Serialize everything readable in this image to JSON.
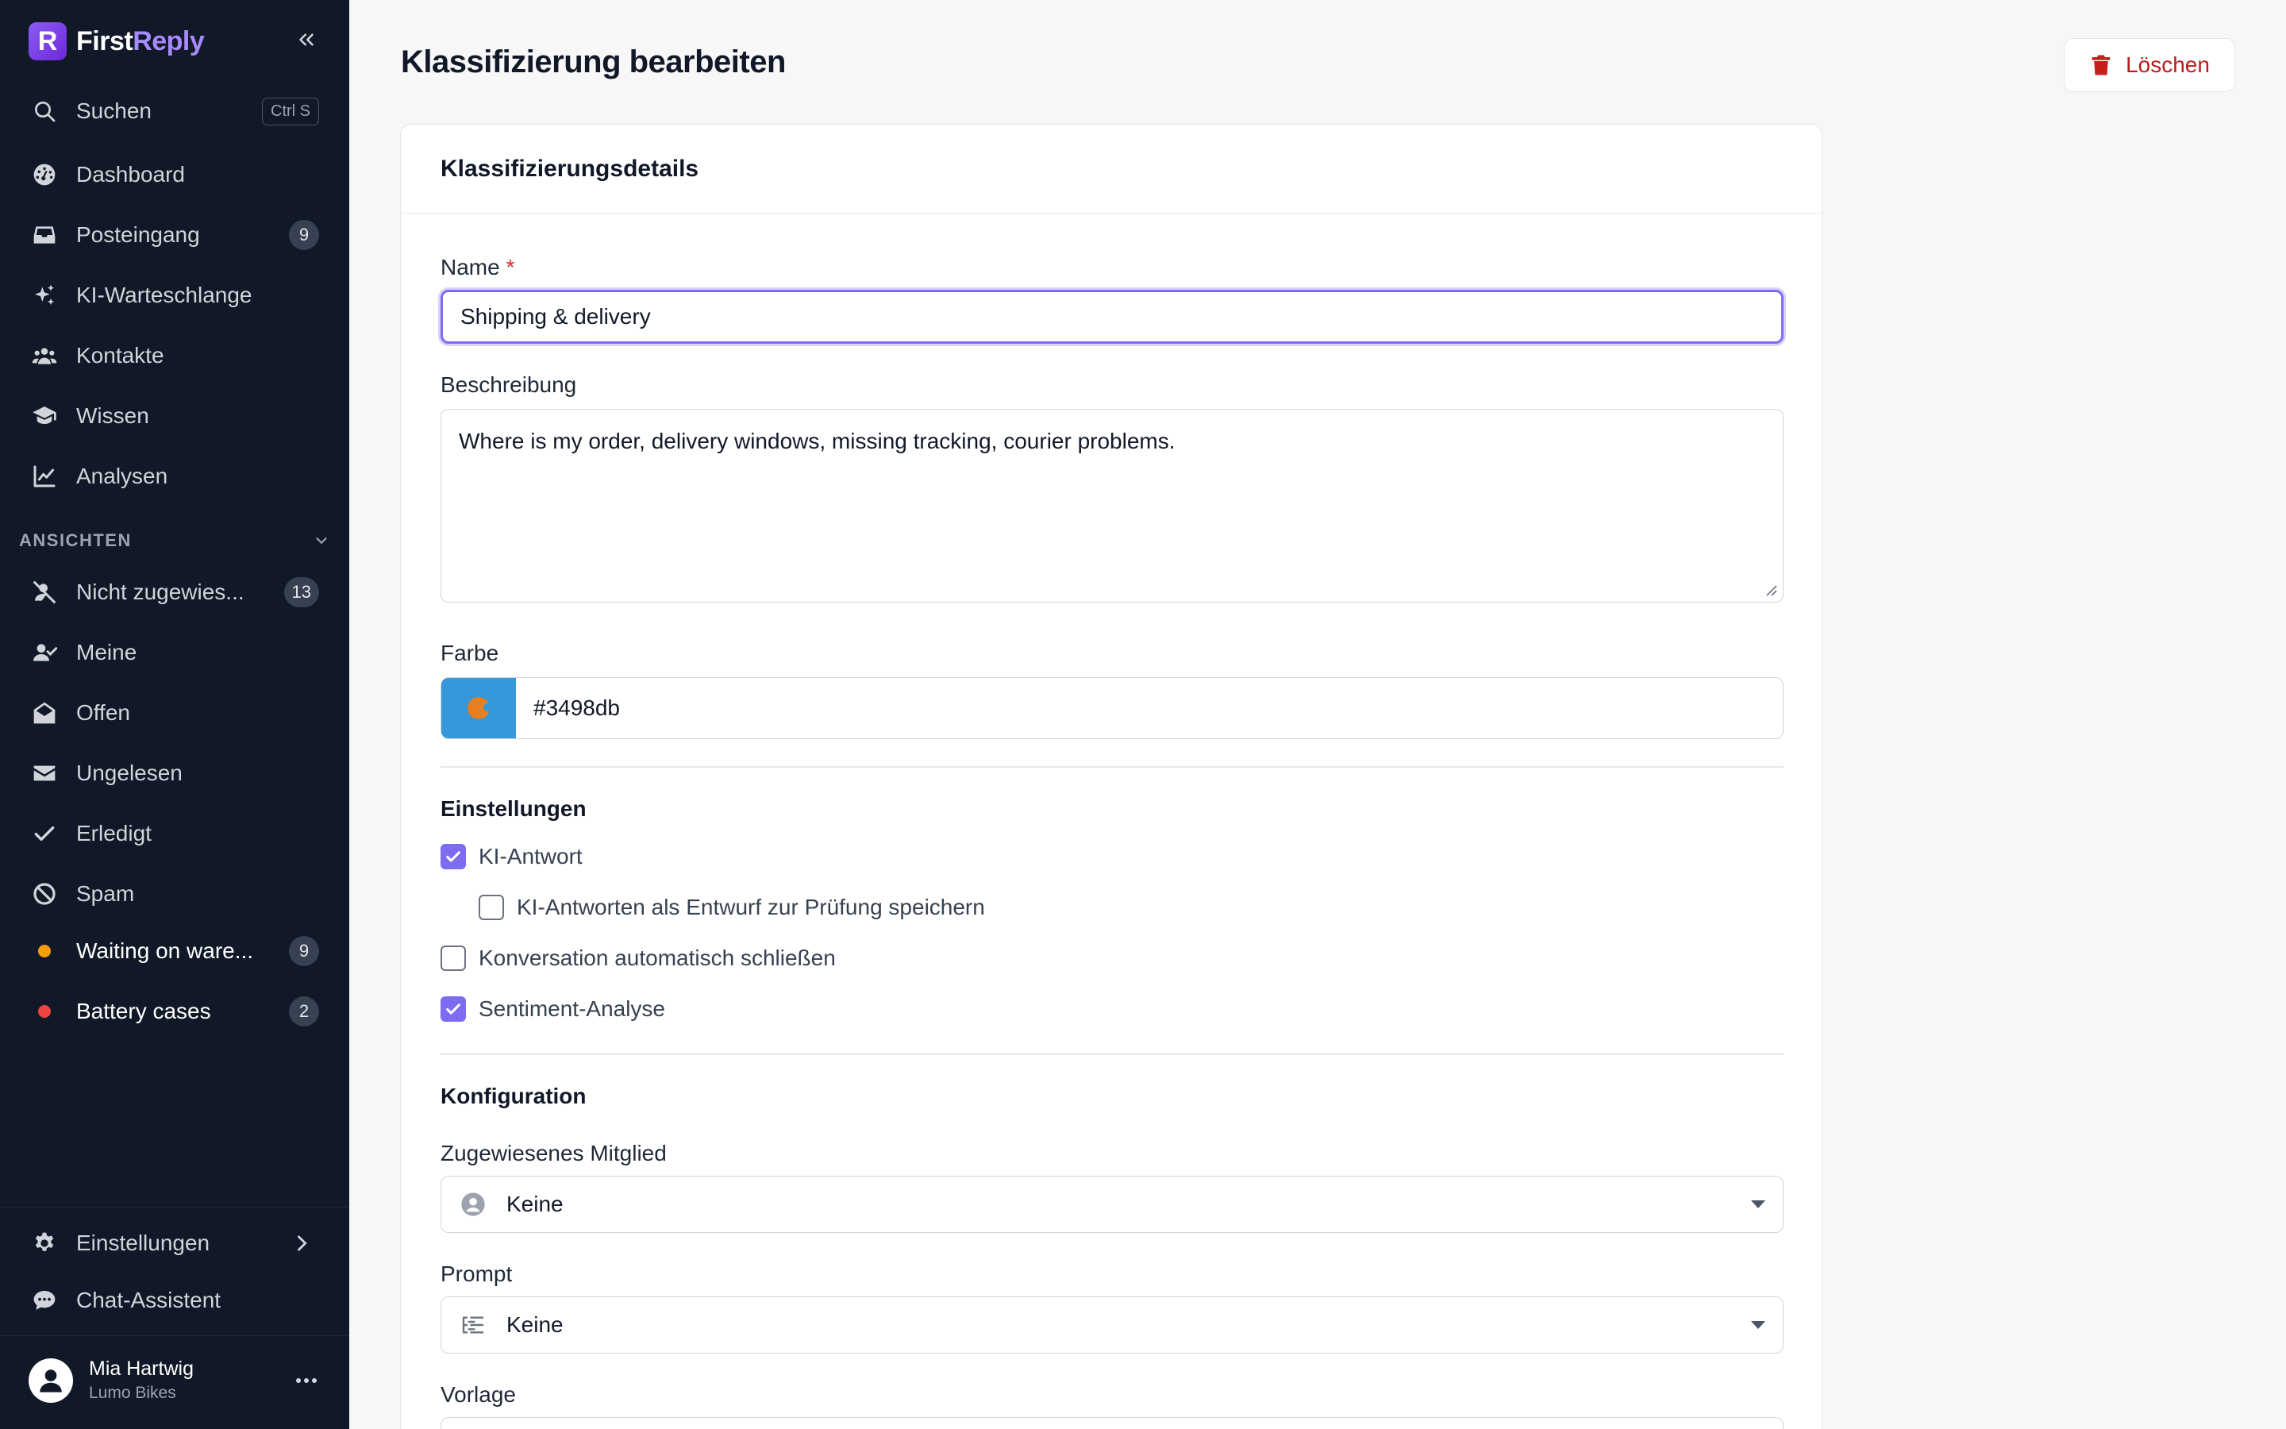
{
  "brand": {
    "name_first": "First",
    "name_second": "Reply",
    "logo_letter": "R"
  },
  "sidebar": {
    "search": {
      "label": "Suchen",
      "shortcut": "Ctrl S"
    },
    "main_items": [
      {
        "label": "Dashboard",
        "icon": "dashboard-icon"
      },
      {
        "label": "Posteingang",
        "icon": "inbox-icon",
        "badge": "9"
      },
      {
        "label": "KI-Warteschlange",
        "icon": "sparkles-icon"
      },
      {
        "label": "Kontakte",
        "icon": "users-icon"
      },
      {
        "label": "Wissen",
        "icon": "graduation-cap-icon"
      },
      {
        "label": "Analysen",
        "icon": "chart-line-icon"
      }
    ],
    "views_label": "ANSICHTEN",
    "views": [
      {
        "label": "Nicht zugewies...",
        "icon": "user-slash-icon",
        "badge": "13"
      },
      {
        "label": "Meine",
        "icon": "user-check-icon"
      },
      {
        "label": "Offen",
        "icon": "envelope-open-icon"
      },
      {
        "label": "Ungelesen",
        "icon": "envelope-icon"
      },
      {
        "label": "Erledigt",
        "icon": "check-icon"
      },
      {
        "label": "Spam",
        "icon": "ban-icon"
      },
      {
        "label": "Waiting on ware...",
        "dot_color": "#f59e0b",
        "badge": "9"
      },
      {
        "label": "Battery cases",
        "dot_color": "#ef4444",
        "badge": "2"
      }
    ],
    "settings": {
      "label": "Einstellungen"
    },
    "chat": {
      "label": "Chat-Assistent"
    },
    "user": {
      "name": "Mia Hartwig",
      "org": "Lumo Bikes"
    }
  },
  "header": {
    "title": "Klassifizierung bearbeiten",
    "delete_label": "Löschen"
  },
  "form": {
    "card_title": "Klassifizierungsdetails",
    "name": {
      "label": "Name",
      "required": "*",
      "value": "Shipping & delivery"
    },
    "description": {
      "label": "Beschreibung",
      "value": "Where is my order, delivery windows, missing tracking, courier problems."
    },
    "color": {
      "label": "Farbe",
      "value": "#3498db"
    },
    "settings": {
      "title": "Einstellungen",
      "ai_reply": {
        "label": "KI-Antwort",
        "checked": true
      },
      "ai_draft": {
        "label": "KI-Antworten als Entwurf zur Prüfung speichern",
        "checked": false
      },
      "auto_close": {
        "label": "Konversation automatisch schließen",
        "checked": false
      },
      "sentiment": {
        "label": "Sentiment-Analyse",
        "checked": true
      }
    },
    "configuration": {
      "title": "Konfiguration",
      "assigned_member": {
        "label": "Zugewiesenes Mitglied",
        "value": "Keine"
      },
      "prompt": {
        "label": "Prompt",
        "value": "Keine"
      },
      "template": {
        "label": "Vorlage"
      }
    }
  },
  "colors": {
    "sidebar_bg": "#111827",
    "accent": "#7c6cf0",
    "danger": "#b91c1c"
  }
}
